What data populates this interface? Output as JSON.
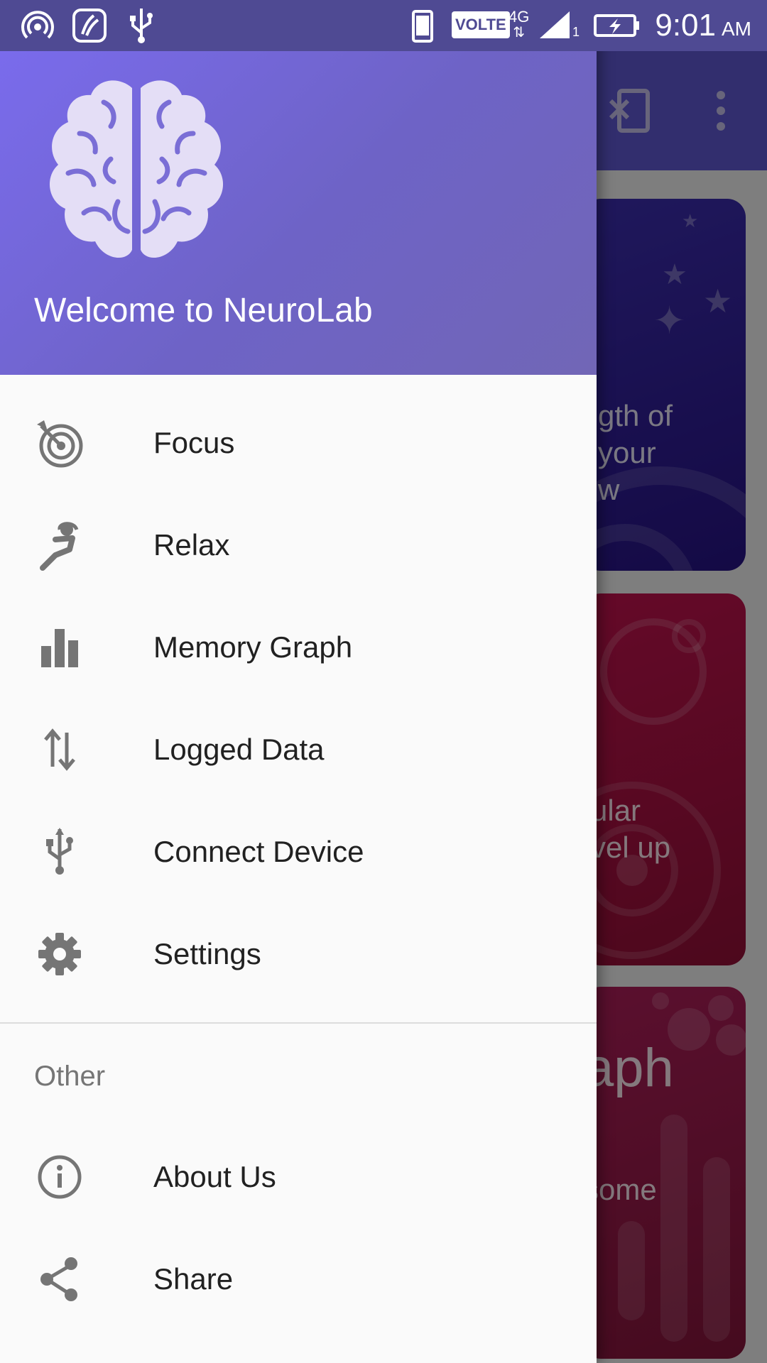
{
  "status_bar": {
    "time": "9:01",
    "ampm": "AM",
    "volte": "VOLTE",
    "network": "4G",
    "sim_slot": "1",
    "icons": [
      "hotspot-icon",
      "saavn-icon",
      "usb-icon",
      "phone-icon",
      "volte-icon",
      "4g-icon",
      "signal-icon",
      "battery-charging-icon"
    ]
  },
  "drawer": {
    "welcome": "Welcome to NeuroLab",
    "logo_icon": "brain-icon",
    "items": [
      {
        "label": "Focus",
        "icon": "target-icon"
      },
      {
        "label": "Relax",
        "icon": "relax-icon"
      },
      {
        "label": "Memory Graph",
        "icon": "bar-chart-icon"
      },
      {
        "label": "Logged Data",
        "icon": "swap-vertical-icon"
      },
      {
        "label": "Connect Device",
        "icon": "usb-icon"
      },
      {
        "label": "Settings",
        "icon": "gear-icon"
      }
    ],
    "other_section_title": "Other",
    "other_items": [
      {
        "label": "About Us",
        "icon": "info-icon"
      },
      {
        "label": "Share",
        "icon": "share-icon"
      }
    ]
  },
  "background": {
    "toolbar_icons": [
      "disconnect-icon",
      "more-vert-icon"
    ],
    "cards": [
      {
        "lines": [
          "gth of",
          "your",
          "w"
        ],
        "color": "#3b1f9e"
      },
      {
        "lines": [
          "ular",
          "vel up"
        ],
        "color": "#a8123f"
      },
      {
        "lines": [
          "aph",
          "some"
        ],
        "color": "#8a1a44"
      }
    ]
  },
  "colors": {
    "status_bar": "#4f4a93",
    "header_start": "#7b6cf0",
    "header_end": "#7166b6",
    "drawer_bg": "#fafafa",
    "icon_gray": "#757575"
  }
}
